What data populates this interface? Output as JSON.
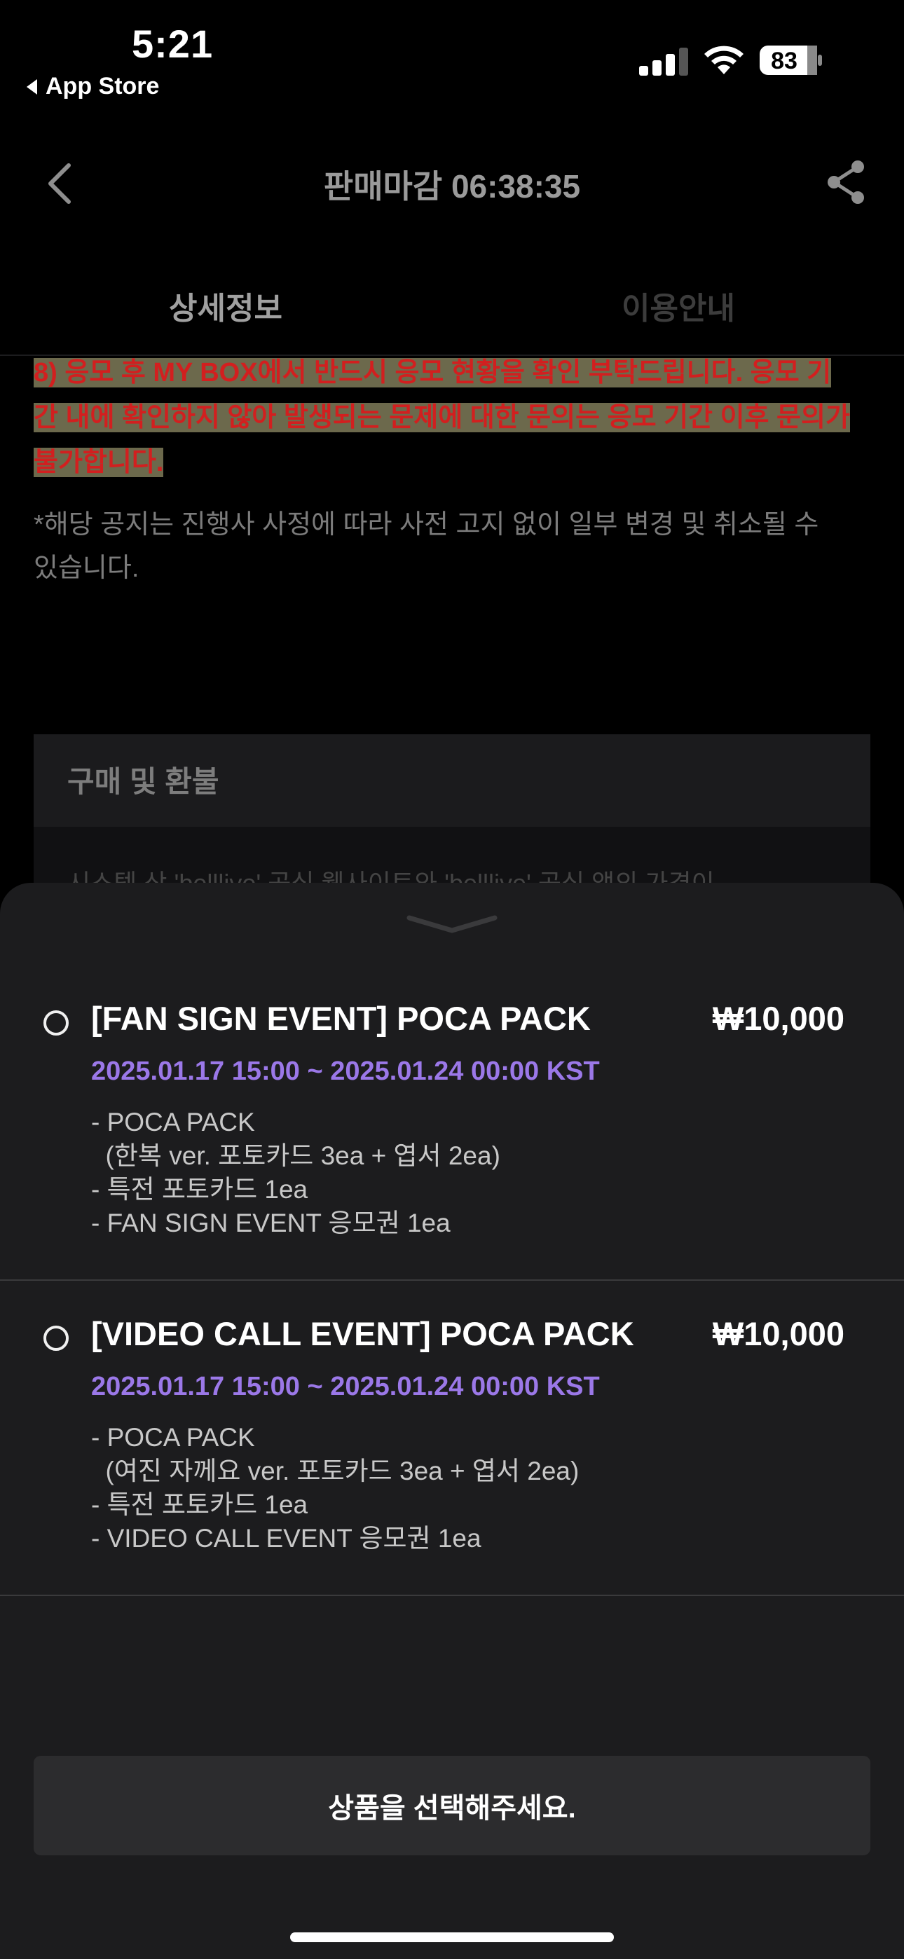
{
  "status_bar": {
    "time": "5:21",
    "back_app": "App Store",
    "battery": "83"
  },
  "nav": {
    "title": "판매마감 06:38:35"
  },
  "tabs": [
    {
      "label": "상세정보",
      "active": true
    },
    {
      "label": "이용안내",
      "active": false
    }
  ],
  "notice": {
    "highlight_lines": [
      "8) 응모 후 MY BOX에서 반드시 응모 현황을 확인 부탁드립니다. 응모 기",
      "간 내에 확인하지 않아 발생되는 문제에 대한 문의는 응모 기간 이후 문의가",
      "불가합니다."
    ],
    "disclaimer_lines": [
      "*해당 공지는 진행사 사정에 따라 사전 고지 없이 일부 변경 및 취소될 수",
      "있습니다."
    ]
  },
  "refund": {
    "title": "구매 및 환불",
    "text_partial": "시스템 상 'belllive' 공식 웹사이트와 'belllive' 공식 앱의 가격이"
  },
  "options": [
    {
      "title": "[FAN SIGN EVENT] POCA PACK",
      "price": "₩10,000",
      "period": "2025.01.17 15:00 ~ 2025.01.24 00:00 KST",
      "desc": "- POCA PACK\n  (한복 ver. 포토카드 3ea + 엽서 2ea)\n- 특전 포토카드 1ea\n- FAN SIGN EVENT 응모권 1ea"
    },
    {
      "title": "[VIDEO CALL EVENT] POCA PACK",
      "price": "₩10,000",
      "period": "2025.01.17 15:00 ~ 2025.01.24 00:00 KST",
      "desc": "- POCA PACK\n  (여진 자께요 ver. 포토카드 3ea + 엽서 2ea)\n- 특전 포토카드 1ea\n- VIDEO CALL EVENT 응모권 1ea"
    }
  ],
  "cta": {
    "label": "상품을 선택해주세요."
  },
  "colors": {
    "accent_purple": "#9b78e8",
    "notice_red": "#d21f1f",
    "highlight": "#6c694c",
    "sheet_bg": "#1c1c1e",
    "button_bg": "#2c2c2e"
  }
}
